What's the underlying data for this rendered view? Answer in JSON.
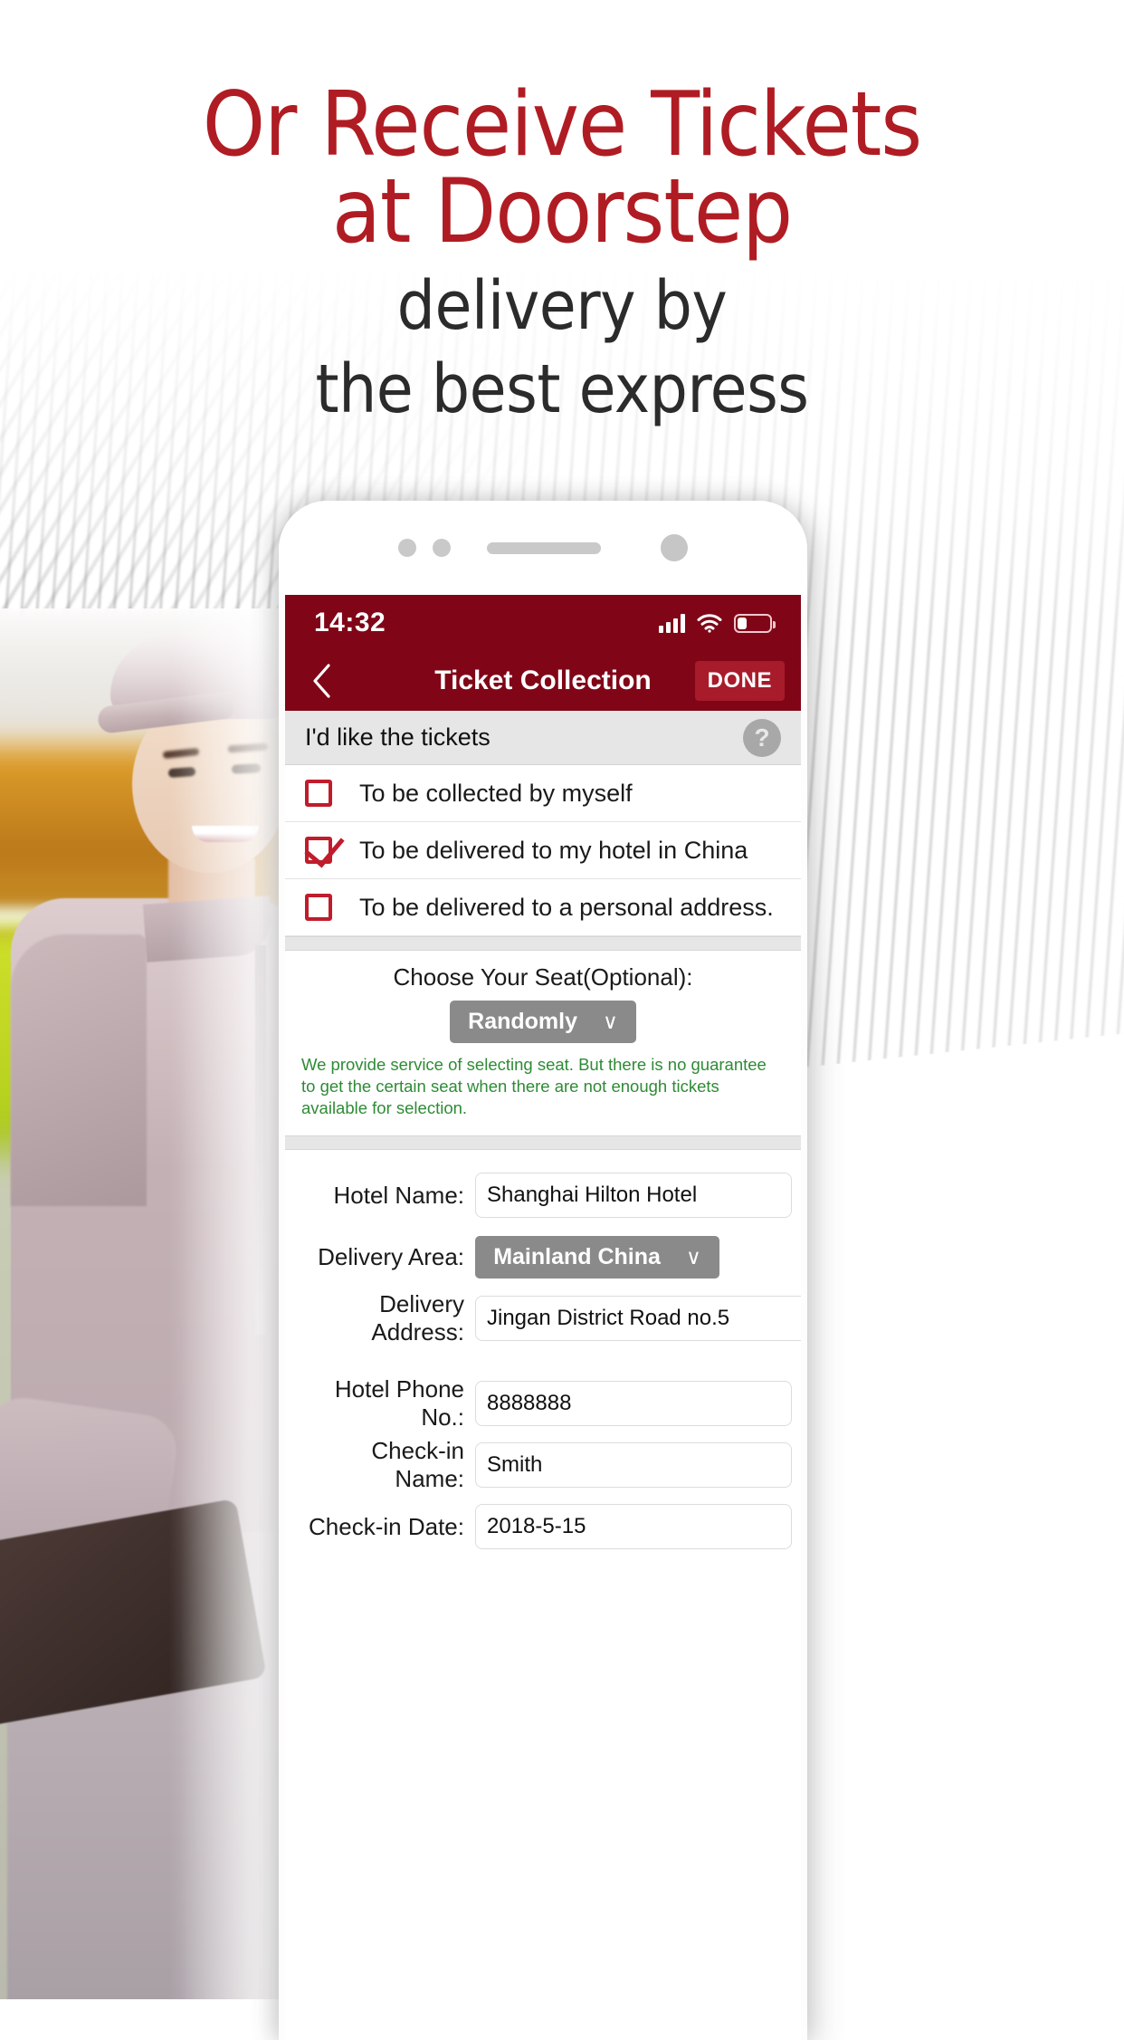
{
  "promo": {
    "headline_line1": "Or Receive Tickets",
    "headline_line2": "at Doorstep",
    "subhead_line1": "delivery by",
    "subhead_line2": "the best express",
    "headline_color": "#b01c23",
    "subhead_color": "#2b2b2b"
  },
  "phone": {
    "status_bar": {
      "time": "14:32",
      "signal_icon": "cellular-bars-icon",
      "wifi_icon": "wifi-icon",
      "battery_icon": "battery-low-icon",
      "background_color": "#800617"
    },
    "nav_bar": {
      "back_icon": "chevron-left-icon",
      "title": "Ticket Collection",
      "done_label": "DONE",
      "done_color": "#a81b2a"
    },
    "section": {
      "label": "I'd like the tickets",
      "help_icon": "question-mark-icon",
      "background_color": "#e6e6e6"
    },
    "options": [
      {
        "label": "To be collected by myself",
        "checked": false
      },
      {
        "label": "To be delivered to my hotel in China",
        "checked": true
      },
      {
        "label": "To be delivered to a personal address.",
        "checked": false
      }
    ],
    "checkbox_color": "#c01c2c",
    "seat": {
      "title": "Choose Your Seat(Optional):",
      "selected": "Randomly",
      "chevron_icon": "chevron-down-icon",
      "note": "We provide service of selecting seat. But there is no guarantee to get the certain seat when there are not enough tickets available for selection.",
      "note_color": "#2e8b35"
    },
    "form": [
      {
        "label": "Hotel Name:",
        "value": "Shanghai Hilton Hotel",
        "type": "text"
      },
      {
        "label": "Delivery Area:",
        "value": "Mainland China",
        "type": "select"
      },
      {
        "label": "Delivery Address:",
        "value": "Jingan District Road no.5",
        "type": "text"
      }
    ],
    "form2": [
      {
        "label": "Hotel Phone No.:",
        "value": "8888888",
        "type": "text"
      },
      {
        "label": "Check-in Name:",
        "value": "Smith",
        "type": "text"
      },
      {
        "label": "Check-in Date:",
        "value": "2018-5-15",
        "type": "text"
      }
    ]
  }
}
